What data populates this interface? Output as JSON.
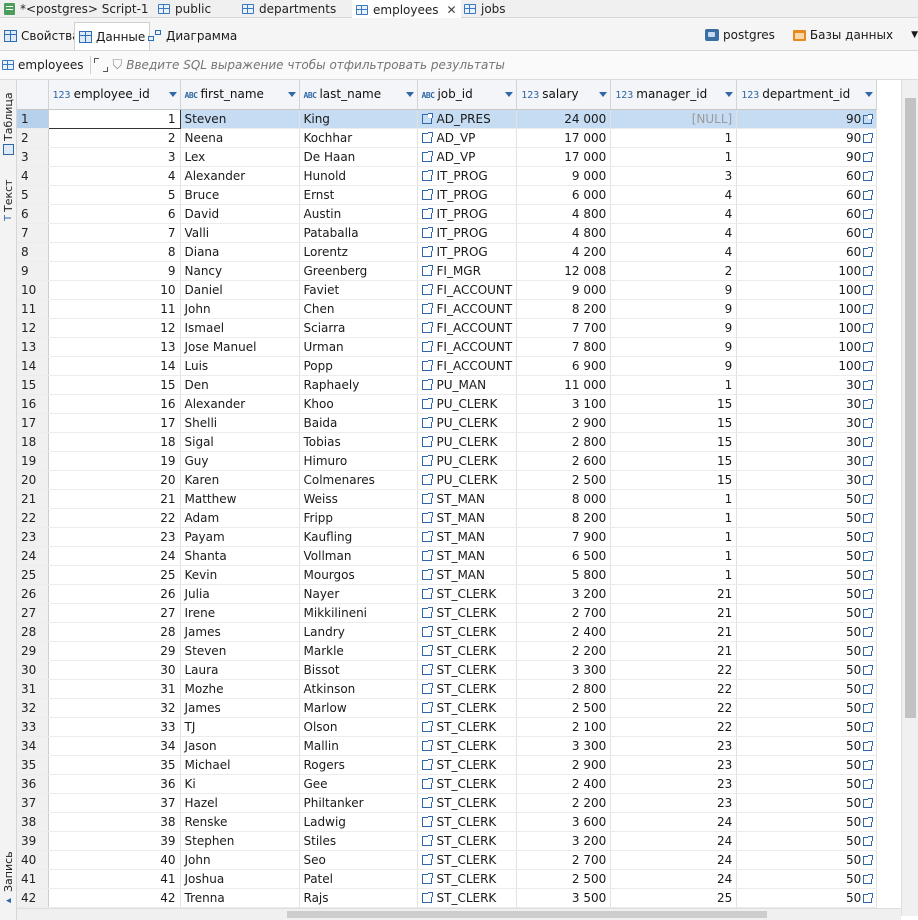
{
  "editor_tabs": [
    {
      "label": "*<postgres> Script-1",
      "icon": "sql-script-icon"
    },
    {
      "label": "public",
      "icon": "schema-table-icon"
    },
    {
      "label": "departments",
      "icon": "table-icon"
    },
    {
      "label": "employees",
      "icon": "table-icon",
      "active": true
    },
    {
      "label": "jobs",
      "icon": "table-icon"
    }
  ],
  "view_tabs": {
    "properties": "Свойства",
    "data": "Данные",
    "diagram": "Диаграмма"
  },
  "connection": {
    "name": "postgres",
    "databases": "Базы данных"
  },
  "filter": {
    "table_name": "employees",
    "placeholder": "Введите SQL выражение чтобы отфильтровать результаты"
  },
  "side_panel": {
    "table": "Таблица",
    "text": "Текст",
    "record": "Запись"
  },
  "columns": [
    {
      "type": "123",
      "name": "employee_id"
    },
    {
      "type": "ABC",
      "name": "first_name"
    },
    {
      "type": "ABC",
      "name": "last_name"
    },
    {
      "type": "ABC",
      "name": "job_id"
    },
    {
      "type": "123",
      "name": "salary"
    },
    {
      "type": "123",
      "name": "manager_id"
    },
    {
      "type": "123",
      "name": "department_id"
    }
  ],
  "rows": [
    [
      "1",
      "1",
      "Steven",
      "King",
      "AD_PRES",
      "24 000",
      "[NULL]",
      "90"
    ],
    [
      "2",
      "2",
      "Neena",
      "Kochhar",
      "AD_VP",
      "17 000",
      "1",
      "90"
    ],
    [
      "3",
      "3",
      "Lex",
      "De Haan",
      "AD_VP",
      "17 000",
      "1",
      "90"
    ],
    [
      "4",
      "4",
      "Alexander",
      "Hunold",
      "IT_PROG",
      "9 000",
      "3",
      "60"
    ],
    [
      "5",
      "5",
      "Bruce",
      "Ernst",
      "IT_PROG",
      "6 000",
      "4",
      "60"
    ],
    [
      "6",
      "6",
      "David",
      "Austin",
      "IT_PROG",
      "4 800",
      "4",
      "60"
    ],
    [
      "7",
      "7",
      "Valli",
      "Pataballa",
      "IT_PROG",
      "4 800",
      "4",
      "60"
    ],
    [
      "8",
      "8",
      "Diana",
      "Lorentz",
      "IT_PROG",
      "4 200",
      "4",
      "60"
    ],
    [
      "9",
      "9",
      "Nancy",
      "Greenberg",
      "FI_MGR",
      "12 008",
      "2",
      "100"
    ],
    [
      "10",
      "10",
      "Daniel",
      "Faviet",
      "FI_ACCOUNT",
      "9 000",
      "9",
      "100"
    ],
    [
      "11",
      "11",
      "John",
      "Chen",
      "FI_ACCOUNT",
      "8 200",
      "9",
      "100"
    ],
    [
      "12",
      "12",
      "Ismael",
      "Sciarra",
      "FI_ACCOUNT",
      "7 700",
      "9",
      "100"
    ],
    [
      "13",
      "13",
      "Jose Manuel",
      "Urman",
      "FI_ACCOUNT",
      "7 800",
      "9",
      "100"
    ],
    [
      "14",
      "14",
      "Luis",
      "Popp",
      "FI_ACCOUNT",
      "6 900",
      "9",
      "100"
    ],
    [
      "15",
      "15",
      "Den",
      "Raphaely",
      "PU_MAN",
      "11 000",
      "1",
      "30"
    ],
    [
      "16",
      "16",
      "Alexander",
      "Khoo",
      "PU_CLERK",
      "3 100",
      "15",
      "30"
    ],
    [
      "17",
      "17",
      "Shelli",
      "Baida",
      "PU_CLERK",
      "2 900",
      "15",
      "30"
    ],
    [
      "18",
      "18",
      "Sigal",
      "Tobias",
      "PU_CLERK",
      "2 800",
      "15",
      "30"
    ],
    [
      "19",
      "19",
      "Guy",
      "Himuro",
      "PU_CLERK",
      "2 600",
      "15",
      "30"
    ],
    [
      "20",
      "20",
      "Karen",
      "Colmenares",
      "PU_CLERK",
      "2 500",
      "15",
      "30"
    ],
    [
      "21",
      "21",
      "Matthew",
      "Weiss",
      "ST_MAN",
      "8 000",
      "1",
      "50"
    ],
    [
      "22",
      "22",
      "Adam",
      "Fripp",
      "ST_MAN",
      "8 200",
      "1",
      "50"
    ],
    [
      "23",
      "23",
      "Payam",
      "Kaufling",
      "ST_MAN",
      "7 900",
      "1",
      "50"
    ],
    [
      "24",
      "24",
      "Shanta",
      "Vollman",
      "ST_MAN",
      "6 500",
      "1",
      "50"
    ],
    [
      "25",
      "25",
      "Kevin",
      "Mourgos",
      "ST_MAN",
      "5 800",
      "1",
      "50"
    ],
    [
      "26",
      "26",
      "Julia",
      "Nayer",
      "ST_CLERK",
      "3 200",
      "21",
      "50"
    ],
    [
      "27",
      "27",
      "Irene",
      "Mikkilineni",
      "ST_CLERK",
      "2 700",
      "21",
      "50"
    ],
    [
      "28",
      "28",
      "James",
      "Landry",
      "ST_CLERK",
      "2 400",
      "21",
      "50"
    ],
    [
      "29",
      "29",
      "Steven",
      "Markle",
      "ST_CLERK",
      "2 200",
      "21",
      "50"
    ],
    [
      "30",
      "30",
      "Laura",
      "Bissot",
      "ST_CLERK",
      "3 300",
      "22",
      "50"
    ],
    [
      "31",
      "31",
      "Mozhe",
      "Atkinson",
      "ST_CLERK",
      "2 800",
      "22",
      "50"
    ],
    [
      "32",
      "32",
      "James",
      "Marlow",
      "ST_CLERK",
      "2 500",
      "22",
      "50"
    ],
    [
      "33",
      "33",
      "TJ",
      "Olson",
      "ST_CLERK",
      "2 100",
      "22",
      "50"
    ],
    [
      "34",
      "34",
      "Jason",
      "Mallin",
      "ST_CLERK",
      "3 300",
      "23",
      "50"
    ],
    [
      "35",
      "35",
      "Michael",
      "Rogers",
      "ST_CLERK",
      "2 900",
      "23",
      "50"
    ],
    [
      "36",
      "36",
      "Ki",
      "Gee",
      "ST_CLERK",
      "2 400",
      "23",
      "50"
    ],
    [
      "37",
      "37",
      "Hazel",
      "Philtanker",
      "ST_CLERK",
      "2 200",
      "23",
      "50"
    ],
    [
      "38",
      "38",
      "Renske",
      "Ladwig",
      "ST_CLERK",
      "3 600",
      "24",
      "50"
    ],
    [
      "39",
      "39",
      "Stephen",
      "Stiles",
      "ST_CLERK",
      "3 200",
      "24",
      "50"
    ],
    [
      "40",
      "40",
      "John",
      "Seo",
      "ST_CLERK",
      "2 700",
      "24",
      "50"
    ],
    [
      "41",
      "41",
      "Joshua",
      "Patel",
      "ST_CLERK",
      "2 500",
      "24",
      "50"
    ],
    [
      "42",
      "42",
      "Trenna",
      "Rajs",
      "ST_CLERK",
      "3 500",
      "25",
      "50"
    ]
  ]
}
